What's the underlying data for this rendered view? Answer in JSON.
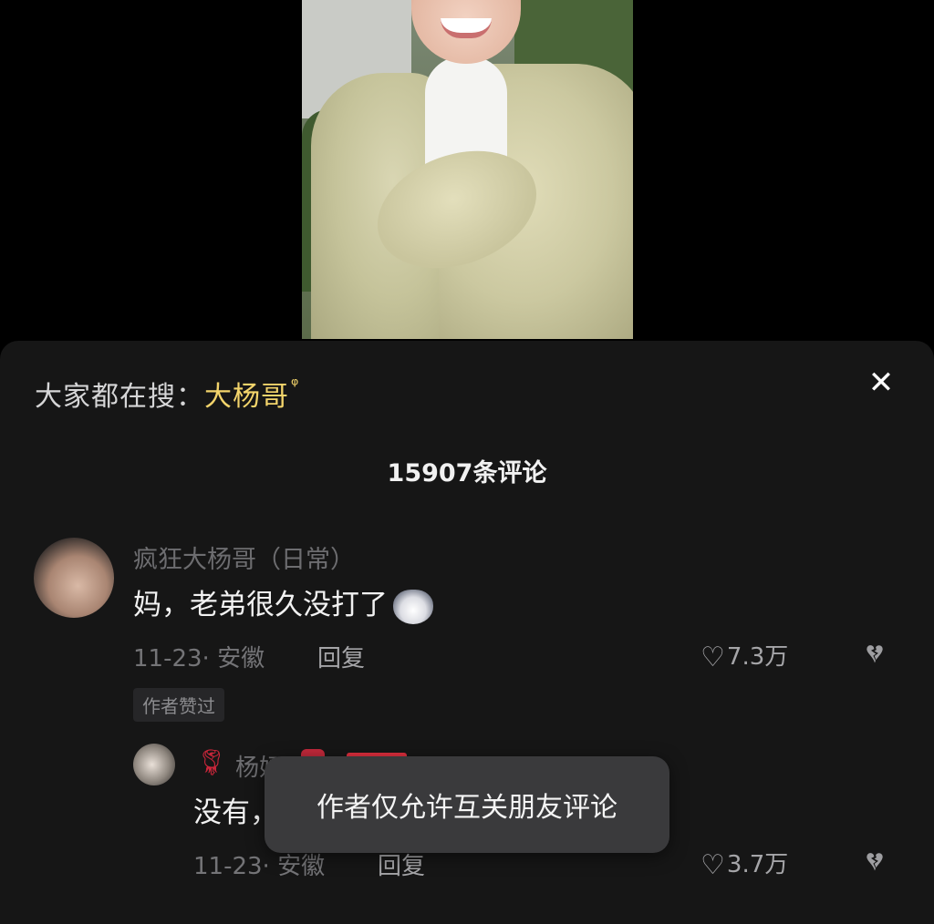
{
  "hot_search": {
    "prefix": "大家都在搜：",
    "keyword": "大杨哥",
    "search_icon": "search-icon"
  },
  "close_icon": "✕",
  "comment_count": "15907条评论",
  "comments": [
    {
      "username": "疯狂大杨哥（日常）",
      "text": "妈，老弟很久没打了",
      "date_location": "11-23· 安徽",
      "reply_label": "回复",
      "likes": "7.3万",
      "author_liked": "作者赞过"
    },
    {
      "username": "杨妈",
      "text": "没有，",
      "date_location": "11-23· 安徽",
      "reply_label": "回复",
      "likes": "3.7万"
    }
  ],
  "toast": "作者仅允许互关朋友评论",
  "colors": {
    "keyword": "#f3d46b",
    "panel_bg": "#161616",
    "toast_bg": "#3a3a3c"
  }
}
